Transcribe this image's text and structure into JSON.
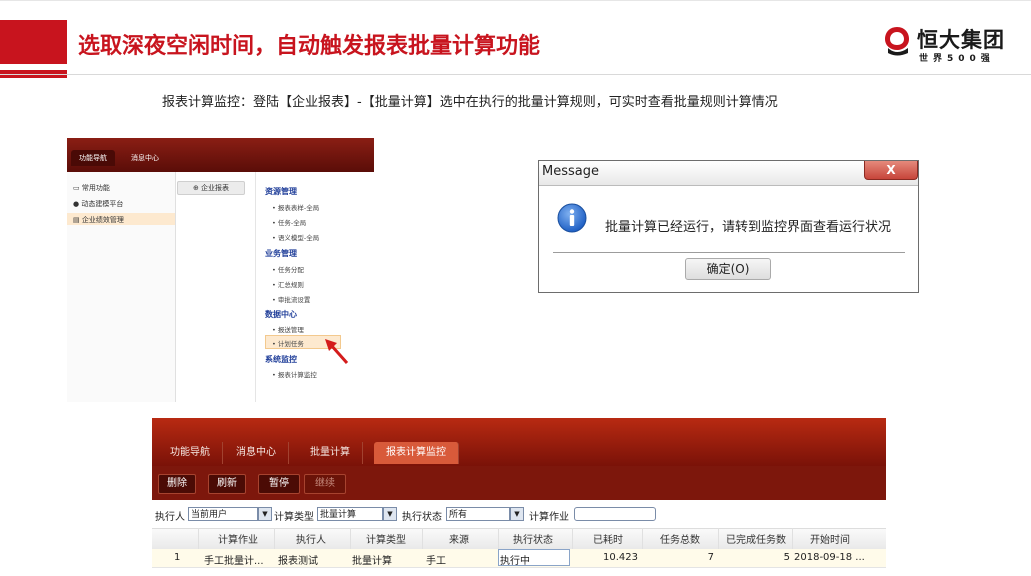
{
  "slide": {
    "title": "选取深夜空闲时间，自动触发报表批量计算功能",
    "logo_text": "恒大集团",
    "logo_sub": "世界500强",
    "description": "报表计算监控：登陆【企业报表】-【批量计算】选中在执行的批量计算规则，可实时查看批量规则计算情况"
  },
  "screenshot_nav": {
    "tabs": [
      "功能导航",
      "消息中心"
    ],
    "left_menu": [
      "常用功能",
      "动态建模平台",
      "企业绩效管理"
    ],
    "module_button": "企业报表",
    "groups": [
      {
        "heading": "资源管理",
        "items": [
          "报表表样-全局",
          "任务-全局",
          "语义模型-全局"
        ]
      },
      {
        "heading": "业务管理",
        "items": [
          "任务分配",
          "汇总规则",
          "审批流设置"
        ]
      },
      {
        "heading": "数据中心",
        "items": [
          "报送管理",
          "计划任务"
        ]
      },
      {
        "heading": "系统监控",
        "items": [
          "报表计算监控"
        ]
      }
    ]
  },
  "message_box": {
    "title": "Message",
    "close": "X",
    "text": "批量计算已经运行，请转到监控界面查看运行状况",
    "ok_button": "确定(O)"
  },
  "monitor": {
    "tabs": [
      "功能导航",
      "消息中心",
      "批量计算",
      "报表计算监控"
    ],
    "toolbar": [
      "删除",
      "刷新",
      "暂停",
      "继续"
    ],
    "filters": {
      "executor_label": "执行人",
      "executor_value": "当前用户",
      "type_label": "计算类型",
      "type_value": "批量计算",
      "status_label": "执行状态",
      "status_value": "所有",
      "job_label": "计算作业"
    },
    "columns": [
      "计算作业",
      "执行人",
      "计算类型",
      "来源",
      "执行状态",
      "已耗时",
      "任务总数",
      "已完成任务数",
      "开始时间"
    ],
    "rows": [
      {
        "index": "1",
        "job": "手工批量计...",
        "executor": "报表测试",
        "type": "批量计算",
        "source": "手工",
        "status": "执行中",
        "elapsed": "10.423",
        "total": "7",
        "done": "5",
        "start": "2018-09-18 ..."
      }
    ]
  },
  "colors": {
    "brand_red": "#c8141e",
    "dark_red": "#7d170c",
    "link_blue": "#23419b"
  }
}
